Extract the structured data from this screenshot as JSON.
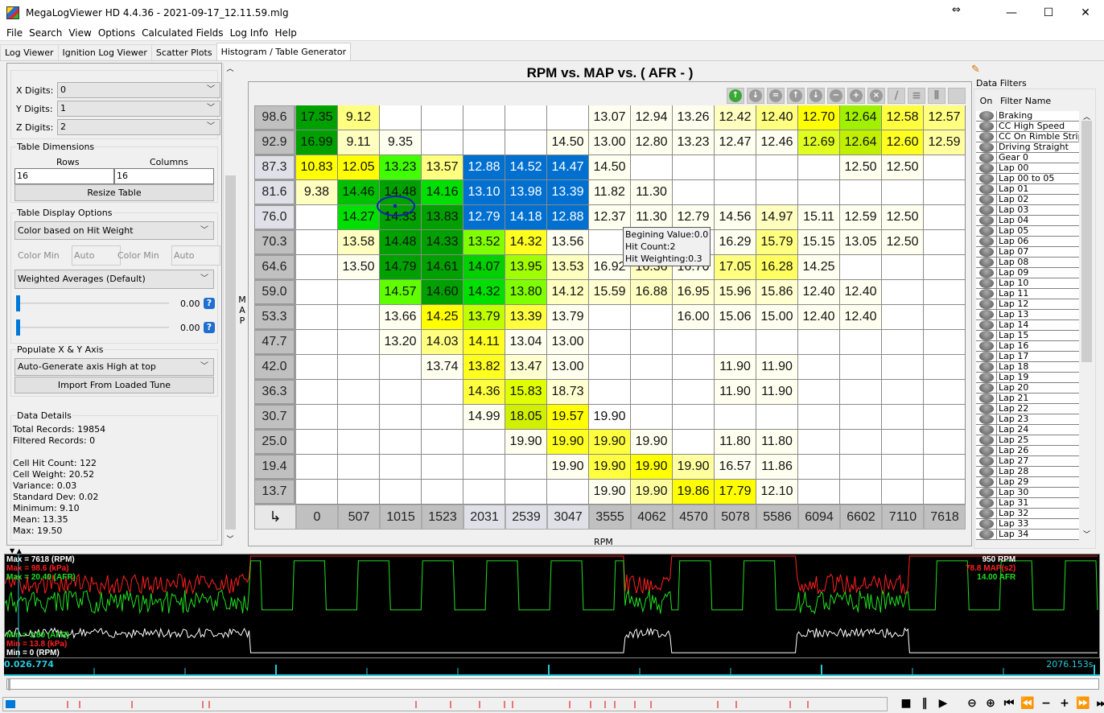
{
  "window": {
    "title": "MegaLogViewer HD 4.4.36 - 2021-09-17_12.11.59.mlg",
    "controls": {
      "minimize": "—",
      "maximize": "☐",
      "close": "✕",
      "resize": "⇔"
    }
  },
  "menu": [
    "File",
    "Search",
    "View",
    "Options",
    "Calculated Fields",
    "Log Info",
    "Help"
  ],
  "tabs": [
    {
      "label": "Log Viewer",
      "active": false
    },
    {
      "label": "Ignition Log Viewer",
      "active": false
    },
    {
      "label": "Scatter Plots",
      "active": false
    },
    {
      "label": "Histogram / Table Generator",
      "active": true
    }
  ],
  "left_panel": {
    "x_digits_label": "X Digits:",
    "x_digits": "0",
    "y_digits_label": "Y Digits:",
    "y_digits": "1",
    "z_digits_label": "Z Digits:",
    "z_digits": "2",
    "table_dimensions": {
      "title": "Table Dimensions",
      "rows_label": "Rows",
      "rows": "16",
      "columns_label": "Columns",
      "columns": "16",
      "resize_button": "Resize Table"
    },
    "display_options": {
      "title": "Table Display Options",
      "color_mode": "Color based on Hit Weight",
      "color_min_label": "Color Min",
      "color_min_value": "Auto",
      "color_max_label": "Color Min",
      "color_max_value": "Auto",
      "averaging": "Weighted Averages (Default)",
      "slider1_value": "0.00",
      "slider2_value": "0.00"
    },
    "populate_axis": {
      "title": "Populate X & Y Axis",
      "mode": "Auto-Generate axis High at top",
      "import_button": "Import From Loaded Tune"
    },
    "data_details": {
      "title": "Data Details",
      "lines": [
        "Total Records: 19854",
        "Filtered Records: 0",
        "",
        "Cell Hit Count: 122",
        "Cell Weight: 20.52",
        "Variance: 0.03",
        "Standard Dev: 0.02",
        "Minimum: 9.10",
        "Mean: 13.35",
        "Max: 19.50"
      ]
    }
  },
  "table": {
    "title": "RPM vs. MAP vs. ( AFR -   )",
    "y_axis_label": "MAP",
    "x_axis_label": "RPM",
    "corner_icon": "↳",
    "x_values": [
      "0",
      "507",
      "1015",
      "1523",
      "2031",
      "2539",
      "3047",
      "3555",
      "4062",
      "4570",
      "5078",
      "5586",
      "6094",
      "6602",
      "7110",
      "7618"
    ],
    "y_values": [
      "98.6",
      "92.9",
      "87.3",
      "81.6",
      "76.0",
      "70.3",
      "64.6",
      "59.0",
      "53.3",
      "47.7",
      "42.0",
      "36.3",
      "30.7",
      "25.0",
      "19.4",
      "13.7"
    ],
    "rows": [
      [
        "17.35",
        "9.12",
        "",
        "",
        "",
        "",
        "",
        "13.07",
        "12.94",
        "13.26",
        "12.42",
        "12.40",
        "12.70",
        "12.64",
        "12.58",
        "12.57"
      ],
      [
        "16.99",
        "9.11",
        "9.35",
        "",
        "",
        "",
        "14.50",
        "13.00",
        "12.80",
        "13.23",
        "12.47",
        "12.46",
        "12.69",
        "12.64",
        "12.60",
        "12.59"
      ],
      [
        "10.83",
        "12.05",
        "13.23",
        "13.57",
        "12.88",
        "14.52",
        "14.47",
        "14.50",
        "",
        "",
        "",
        "",
        "",
        "12.50",
        "12.50",
        ""
      ],
      [
        "9.38",
        "14.46",
        "14.48",
        "14.16",
        "13.10",
        "13.98",
        "13.39",
        "11.82",
        "11.30",
        "",
        "",
        "",
        "",
        "",
        "",
        ""
      ],
      [
        "",
        "14.27",
        "14.33",
        "13.83",
        "12.79",
        "14.18",
        "12.88",
        "12.37",
        "11.30",
        "12.79",
        "14.56",
        "14.97",
        "15.11",
        "12.59",
        "12.50",
        ""
      ],
      [
        "",
        "13.58",
        "14.48",
        "14.33",
        "13.52",
        "14.32",
        "13.56",
        "",
        "",
        "",
        "16.29",
        "15.79",
        "15.15",
        "13.05",
        "12.50",
        ""
      ],
      [
        "",
        "13.50",
        "14.79",
        "14.61",
        "14.07",
        "13.95",
        "13.53",
        "16.92",
        "16.36",
        "16.70",
        "17.05",
        "16.28",
        "14.25",
        "",
        "",
        ""
      ],
      [
        "",
        "",
        "14.57",
        "14.60",
        "14.32",
        "13.80",
        "14.12",
        "15.59",
        "16.88",
        "16.95",
        "15.96",
        "15.86",
        "12.40",
        "12.40",
        "",
        ""
      ],
      [
        "",
        "",
        "13.66",
        "14.25",
        "13.79",
        "13.39",
        "13.79",
        "",
        "",
        "16.00",
        "15.06",
        "15.00",
        "12.40",
        "12.40",
        "",
        ""
      ],
      [
        "",
        "",
        "13.20",
        "14.03",
        "14.11",
        "13.04",
        "13.00",
        "",
        "",
        "",
        "",
        "",
        "",
        "",
        "",
        ""
      ],
      [
        "",
        "",
        "",
        "13.74",
        "13.82",
        "13.47",
        "13.00",
        "",
        "",
        "",
        "11.90",
        "11.90",
        "",
        "",
        "",
        ""
      ],
      [
        "",
        "",
        "",
        "",
        "14.36",
        "15.83",
        "18.73",
        "",
        "",
        "",
        "11.90",
        "11.90",
        "",
        "",
        "",
        ""
      ],
      [
        "",
        "",
        "",
        "",
        "14.99",
        "18.05",
        "19.57",
        "19.90",
        "",
        "",
        "",
        "",
        "",
        "",
        "",
        ""
      ],
      [
        "",
        "",
        "",
        "",
        "",
        "19.90",
        "19.90",
        "19.90",
        "19.90",
        "",
        "11.80",
        "11.80",
        "",
        "",
        "",
        ""
      ],
      [
        "",
        "",
        "",
        "",
        "",
        "",
        "19.90",
        "19.90",
        "19.90",
        "19.90",
        "16.57",
        "11.86",
        "",
        "",
        "",
        ""
      ],
      [
        "",
        "",
        "",
        "",
        "",
        "",
        "",
        "19.90",
        "19.90",
        "19.86",
        "17.79",
        "12.10",
        "",
        "",
        "",
        ""
      ]
    ],
    "colors": [
      [
        "#00a000",
        "#ffff80",
        "",
        "",
        "",
        "",
        "",
        "#fffff0",
        "#fffff0",
        "#fffff0",
        "#ffffc0",
        "#ffff80",
        "#ffff00",
        "#a0f000",
        "#ffff40",
        "#ffff80"
      ],
      [
        "#00a000",
        "#ffffc0",
        "#fffff0",
        "",
        "",
        "",
        "#fffff0",
        "#fffff0",
        "#fffff0",
        "#fffff0",
        "#fffff0",
        "#fffff0",
        "#e0ff20",
        "#c0f000",
        "#ffff20",
        "#ffffa0"
      ],
      [
        "#ffff00",
        "#ffff00",
        "#40ff00",
        "#ffff80",
        "#0070d0",
        "#0070d0",
        "#0070d0",
        "#fffff0",
        "",
        "",
        "",
        "",
        "",
        "#fffff0",
        "#fffff0",
        ""
      ],
      [
        "#ffffc0",
        "#00c000",
        "#00a000",
        "#00e000",
        "#0070d0",
        "#0070d0",
        "#0070d0",
        "#fffff0",
        "#fffff0",
        "",
        "",
        "",
        "",
        "",
        "",
        ""
      ],
      [
        "",
        "#00e000",
        "#00a000",
        "#00a000",
        "#0070d0",
        "#0070d0",
        "#0070d0",
        "#fffff0",
        "#fffff0",
        "#fffff0",
        "#fffff0",
        "#ffffc0",
        "#fffff0",
        "#fffff0",
        "#fffff0",
        ""
      ],
      [
        "",
        "#ffffc0",
        "#00a000",
        "#00a000",
        "#80ff00",
        "#ffff20",
        "#fffff0",
        "",
        "",
        "",
        "#fffff0",
        "#ffff80",
        "#fffff0",
        "#fffff0",
        "#fffff0",
        ""
      ],
      [
        "",
        "#fffff0",
        "#00a000",
        "#00a000",
        "#00d000",
        "#a0ff00",
        "#ffffc0",
        "#fffff0",
        "#ffffc0",
        "#fffff0",
        "#ffff80",
        "#ffff60",
        "#fffff0",
        "",
        "",
        ""
      ],
      [
        "",
        "",
        "#60ff00",
        "#00a000",
        "#00e000",
        "#80ff00",
        "#ffffc0",
        "#ffffd0",
        "#ffffc0",
        "#ffffd0",
        "#ffffd0",
        "#ffffd0",
        "#fffff0",
        "#fffff0",
        "",
        ""
      ],
      [
        "",
        "",
        "#fffff0",
        "#ffff00",
        "#c0ff00",
        "#ffff40",
        "#fffff0",
        "",
        "",
        "#fffff0",
        "#fffff0",
        "#fffff0",
        "#fffff0",
        "#fffff0",
        "",
        ""
      ],
      [
        "",
        "",
        "#fffff0",
        "#ffff80",
        "#ffff20",
        "#fffff0",
        "#fffff0",
        "",
        "",
        "",
        "",
        "",
        "",
        "",
        "",
        ""
      ],
      [
        "",
        "",
        "",
        "#fffff0",
        "#ffff20",
        "#ffffd0",
        "#fffff0",
        "",
        "",
        "",
        "#fffff0",
        "#fffff0",
        "",
        "",
        "",
        ""
      ],
      [
        "",
        "",
        "",
        "",
        "#ffff40",
        "#e0ff00",
        "#ffffd0",
        "",
        "",
        "",
        "#fffff0",
        "#fffff0",
        "",
        "",
        "",
        ""
      ],
      [
        "",
        "",
        "",
        "",
        "#fffff0",
        "#d0f000",
        "#ffff00",
        "#ffffff",
        "",
        "",
        "",
        "",
        "",
        "",
        "",
        ""
      ],
      [
        "",
        "",
        "",
        "",
        "",
        "#fffff0",
        "#ffff20",
        "#ffff40",
        "#fffff0",
        "",
        "#fffff0",
        "#fffff0",
        "",
        "",
        "",
        ""
      ],
      [
        "",
        "",
        "",
        "",
        "",
        "",
        "#fffff0",
        "#ffff40",
        "#ffff00",
        "#ffffa0",
        "#fffff0",
        "#fffff0",
        "",
        "",
        "",
        ""
      ],
      [
        "",
        "",
        "",
        "",
        "",
        "",
        "",
        "#fffff0",
        "#ffffa0",
        "#ffff00",
        "#ffff00",
        "#fffff0",
        "",
        "",
        "",
        ""
      ]
    ],
    "light_row_headers": [
      "87.3",
      "81.6",
      "76.0"
    ],
    "light_col_headers": [
      "2031",
      "2539",
      "3047"
    ],
    "tooltip": [
      "Begining Value:0.0",
      "Hit Count:2",
      "Hit Weighting:0.3"
    ],
    "toolbar_icons": [
      "refresh-up-icon",
      "circle-down-icon",
      "equal-icon",
      "arrow-up-icon",
      "arrow-down-icon",
      "minus-icon",
      "plus-icon",
      "clear-icon",
      "pencil-icon",
      "rows-icon",
      "columns-icon",
      "fill-icon"
    ]
  },
  "filters": {
    "title": "Data Filters",
    "col_on": "On",
    "col_name": "Filter Name",
    "items": [
      "Braking",
      "CC High Speed",
      "CC On Rimble Strips",
      "Driving Straight",
      "Gear 0",
      "Lap 00",
      "Lap 00 to 05",
      "Lap 01",
      "Lap 02",
      "Lap 03",
      "Lap 04",
      "Lap 05",
      "Lap 06",
      "Lap 07",
      "Lap 08",
      "Lap 09",
      "Lap 10",
      "Lap 11",
      "Lap 12",
      "Lap 13",
      "Lap 14",
      "Lap 15",
      "Lap 16",
      "Lap 17",
      "Lap 18",
      "Lap 19",
      "Lap 20",
      "Lap 21",
      "Lap 22",
      "Lap 23",
      "Lap 24",
      "Lap 25",
      "Lap 26",
      "Lap 27",
      "Lap 28",
      "Lap 29",
      "Lap 30",
      "Lap 31",
      "Lap 32",
      "Lap 33",
      "Lap 34"
    ]
  },
  "log_chart": {
    "max_labels": [
      {
        "text": "Max = 7618 (RPM)",
        "color": "#ffffff"
      },
      {
        "text": "Max = 98.6 (kPa)",
        "color": "#ff2020"
      },
      {
        "text": "Max = 20.40 (AFR)",
        "color": "#20e020"
      }
    ],
    "min_labels": [
      {
        "text": "Min = 3.80 (AFR)",
        "color": "#20e020"
      },
      {
        "text": "Min = 13.8 (kPa)",
        "color": "#ff2020"
      },
      {
        "text": "Min = 0 (RPM)",
        "color": "#ffffff"
      }
    ],
    "current_values": [
      {
        "value": "950",
        "name": "RPM",
        "color": "#ffffff"
      },
      {
        "value": "78.8",
        "name": "MAP(s2)",
        "color": "#ff2020"
      },
      {
        "value": "14.00",
        "name": "AFR",
        "color": "#20e020"
      }
    ],
    "time_start": "0.026.774",
    "time_end": "2076.153s."
  },
  "playback_controls": [
    "stop-icon",
    "pause-icon",
    "play-icon",
    "zoom-out-icon",
    "zoom-in-icon",
    "skip-start-icon",
    "rewind-icon",
    "minus-icon",
    "plus-icon",
    "fast-forward-icon",
    "skip-end-icon"
  ]
}
